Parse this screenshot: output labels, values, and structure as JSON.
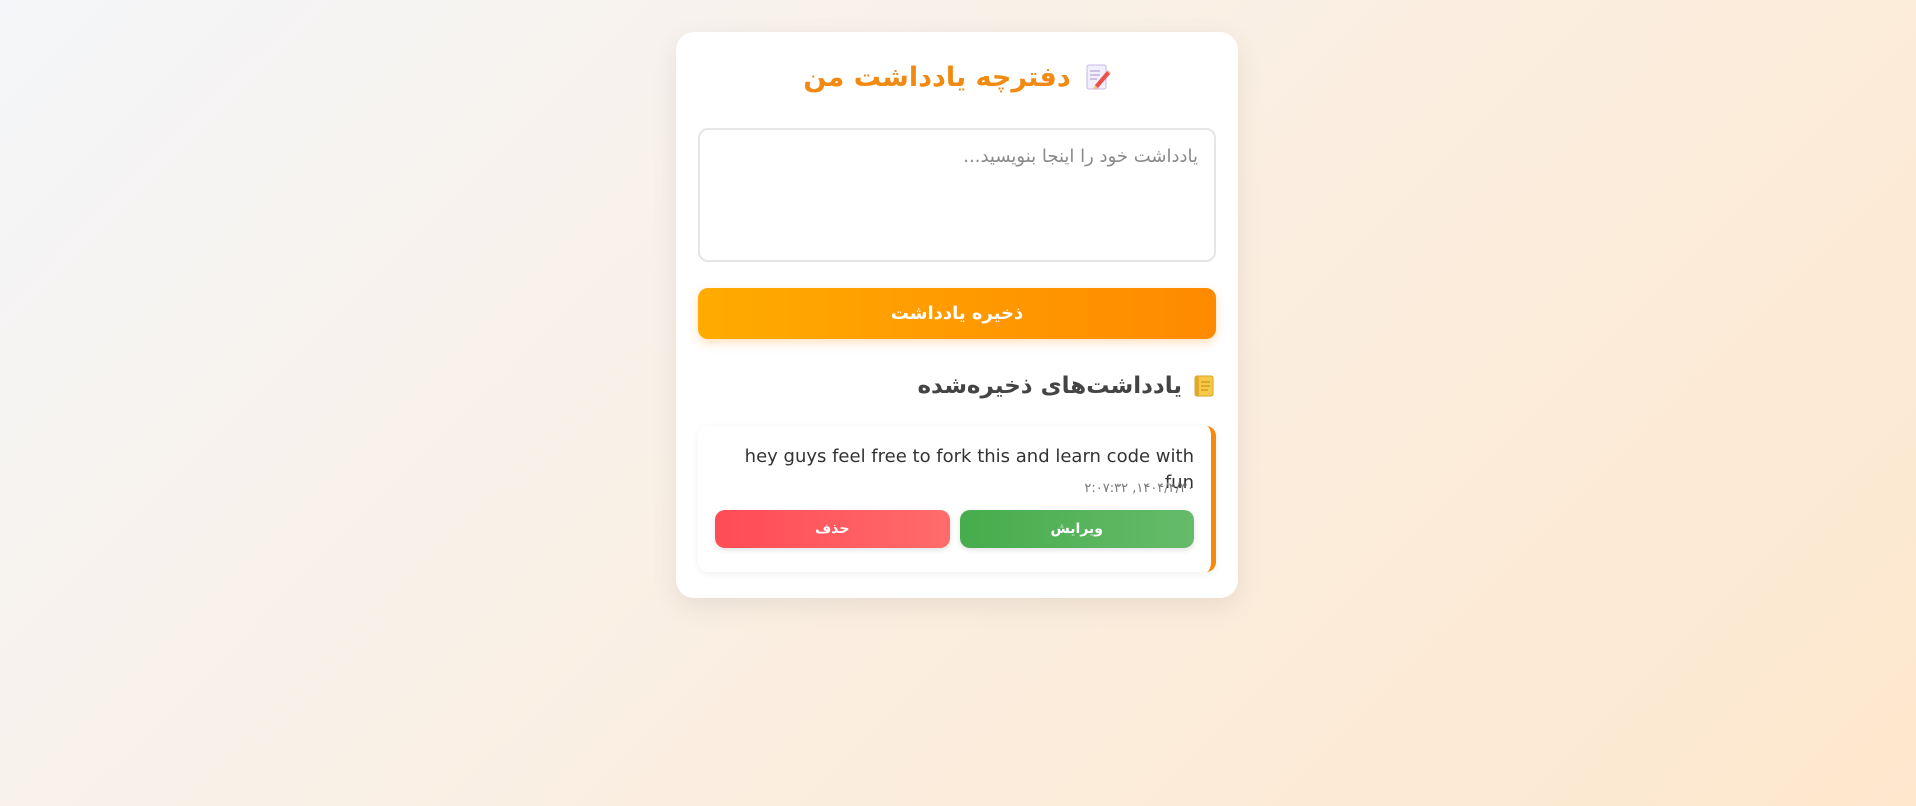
{
  "app": {
    "title": "دفترچه یادداشت من",
    "title_icon": "memo-icon",
    "accent_color": "#f28a12"
  },
  "editor": {
    "placeholder": "یادداشت خود را اینجا بنویسید...",
    "value": ""
  },
  "save_button": {
    "label": "ذخیره یادداشت",
    "colors": [
      "#ffab00",
      "#ff8a00"
    ]
  },
  "saved_section": {
    "heading": "یادداشت‌های ذخیره‌شده",
    "icon": "notebook-icon"
  },
  "notes": [
    {
      "text": "hey guys feel free to fork this and learn code with fun",
      "date": "۱۴۰۴/۴/۳۰, ۲:۰۷:۳۲",
      "edit_label": "ویرایش",
      "delete_label": "حذف"
    }
  ]
}
